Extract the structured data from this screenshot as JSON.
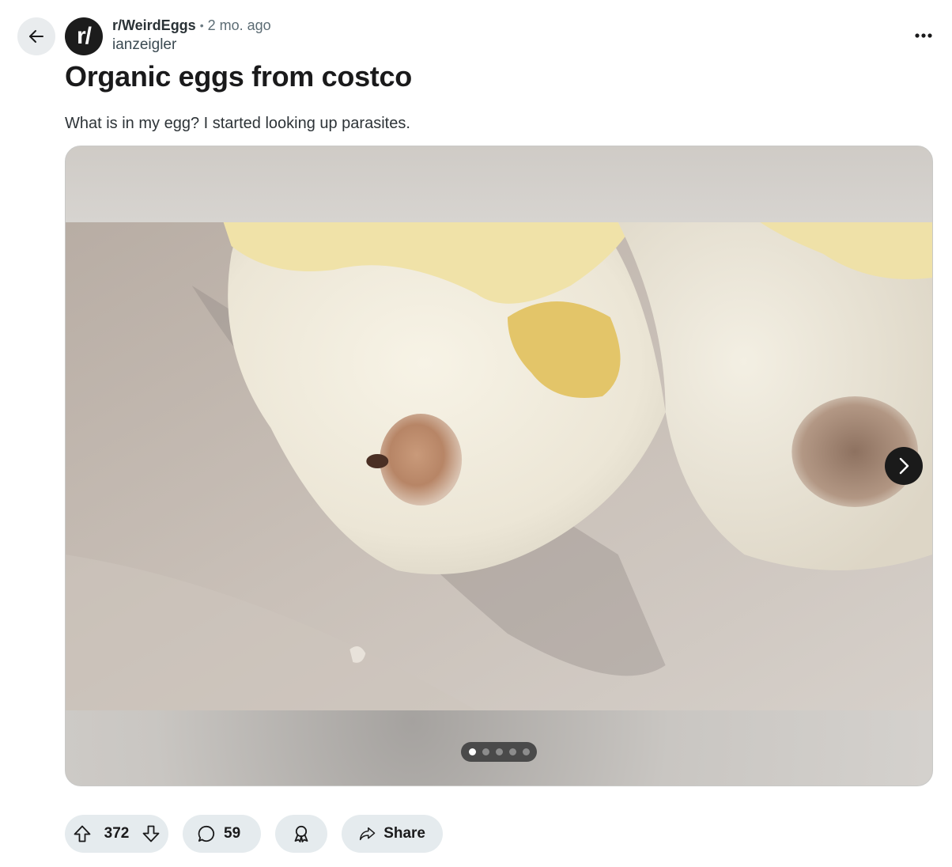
{
  "header": {
    "back_icon": "arrow-left-icon",
    "avatar_text": "r/",
    "subreddit": "r/WeirdEggs",
    "separator": "•",
    "time": "2 mo. ago",
    "user": "ianzeigler",
    "more_icon": "more-horizontal-icon"
  },
  "post": {
    "title": "Organic eggs from costco",
    "body": "What is in my egg? I started looking up parasites."
  },
  "gallery": {
    "current_index": 1,
    "total": 5,
    "next_icon": "chevron-right-icon"
  },
  "actions": {
    "upvote_icon": "upvote-arrow-icon",
    "vote_count": "372",
    "downvote_icon": "downvote-arrow-icon",
    "comment_icon": "comment-bubble-icon",
    "comment_count": "59",
    "award_icon": "award-ribbon-icon",
    "share_icon": "share-arrow-icon",
    "share_label": "Share"
  },
  "colors": {
    "pill_bg": "#e5ebee",
    "avatar_bg": "#1c1c1c",
    "pager_bg": "#4a4a4a"
  }
}
